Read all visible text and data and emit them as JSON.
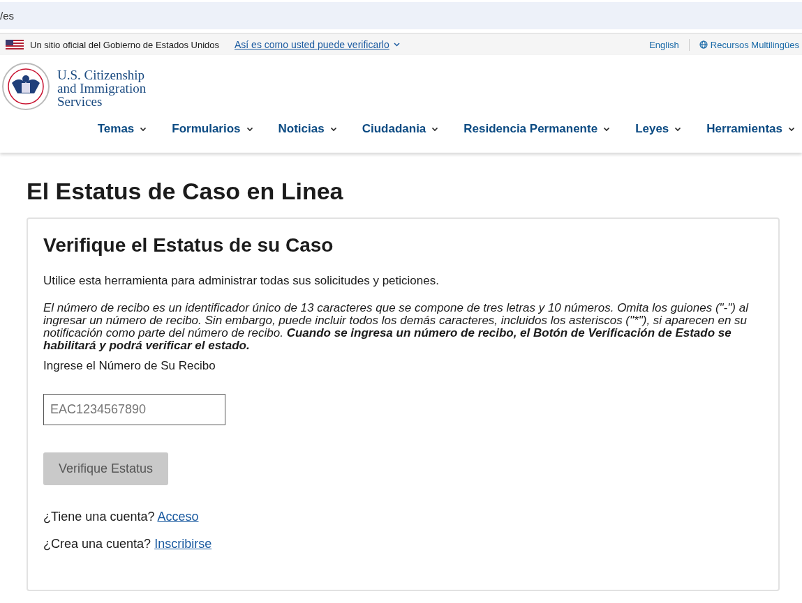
{
  "address_bar": {
    "text": "/es"
  },
  "gov_banner": {
    "text": "Un sitio oficial del Gobierno de Estados Unidos",
    "link": "Así es como usted puede verificarlo",
    "language_link": "English",
    "resources_link": "Recursos Multilingües"
  },
  "logo": {
    "lines": [
      "U.S. Citizenship",
      "and Immigration",
      "Services"
    ]
  },
  "nav": [
    {
      "label": "Temas"
    },
    {
      "label": "Formularios"
    },
    {
      "label": "Noticias"
    },
    {
      "label": "Ciudadania"
    },
    {
      "label": "Residencia Permanente"
    },
    {
      "label": "Leyes"
    },
    {
      "label": "Herramientas"
    }
  ],
  "page_title": "El Estatus de Caso en Linea",
  "card": {
    "title": "Verifique el Estatus de su Caso",
    "intro": "Utilice esta herramienta para administrar todas sus solicitudes y peticiones.",
    "note": "El número de recibo es un identificador único de 13 caracteres que se compone de tres letras y 10 números. Omita los guiones (\"-\") al ingresar un número de recibo. Sin embargo, puede incluir todos los demás caracteres, incluidos los asteriscos (\"*\"), si aparecen en su notificación como parte del número de recibo. **Cuando se ingresa un número de recibo, el Botón de Verificación de Estado se habilitará y podrá verificar el estado.**",
    "field_label": "Ingrese el Número de Su Recibo",
    "field_placeholder": "EAC1234567890",
    "button": {
      "label": "Verifique Estatus",
      "disabled": true
    },
    "links": [
      {
        "text": "¿Tiene una cuenta?",
        "link": "Acceso"
      },
      {
        "text": "¿Crea una cuenta?",
        "link": "Inscribirse"
      }
    ]
  }
}
